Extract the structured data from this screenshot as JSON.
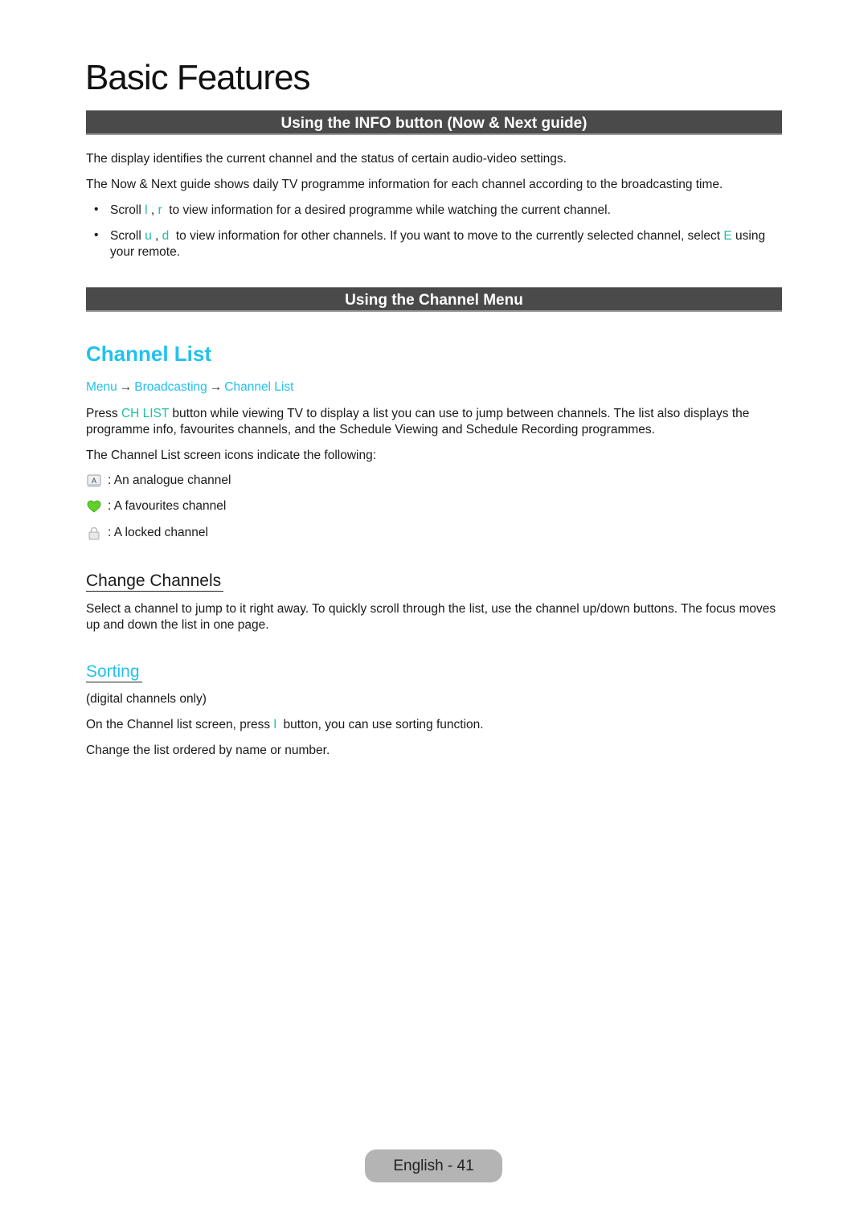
{
  "page": {
    "title": "Basic Features"
  },
  "info_section": {
    "header": "Using the INFO button (Now & Next guide)",
    "para1": "The display identifies the current channel and the status of certain audio-video settings.",
    "para2": "The Now & Next guide shows daily TV programme information for each channel according to the broadcasting time.",
    "bullet1": {
      "prefix": "Scroll ",
      "key1": "l",
      "sep": " , ",
      "key2": "r",
      "suffix": "  to view information for a desired programme while watching the current channel."
    },
    "bullet2": {
      "prefix": "Scroll ",
      "key1": "u",
      "sep": " , ",
      "key2": "d",
      "middle": "  to view information for other channels. If you want to move to the currently selected channel, select ",
      "key3": "E",
      "suffix": " using your remote."
    }
  },
  "channel_menu_section": {
    "header": "Using the Channel Menu"
  },
  "channel_list": {
    "heading": "Channel List",
    "breadcrumb": [
      "Menu",
      "Broadcasting",
      "Channel List"
    ],
    "breadcrumb_arrow": "→",
    "press_prefix": "Press ",
    "press_key": "CH LIST",
    "press_suffix": " button while viewing TV to display a list you can use to jump between channels. The list also displays the programme info, favourites channels, and the Schedule Viewing and Schedule Recording programmes.",
    "icons_intro": "The Channel List screen icons indicate the following:",
    "icons": [
      {
        "icon": "analogue-icon",
        "label": ": An analogue channel"
      },
      {
        "icon": "heart-icon",
        "label": ": A favourites channel"
      },
      {
        "icon": "lock-icon",
        "label": ": A locked channel"
      }
    ]
  },
  "change_channels": {
    "heading": "Change Channels",
    "text": "Select a channel to jump to it right away. To quickly scroll through the list, use the channel up/down buttons. The focus moves up and down the list in one page."
  },
  "sorting": {
    "heading": "Sorting",
    "note": "(digital channels only)",
    "line1_prefix": "On the Channel list screen, press ",
    "line1_key": "l",
    "line1_suffix": "  button, you can use sorting function.",
    "line2": "Change the list ordered by name or number."
  },
  "footer": {
    "page_label": "English - 41"
  },
  "colors": {
    "accent_cyan": "#22c1ee",
    "key_green": "#1fbfa0",
    "section_bar": "#4a4a4a"
  }
}
